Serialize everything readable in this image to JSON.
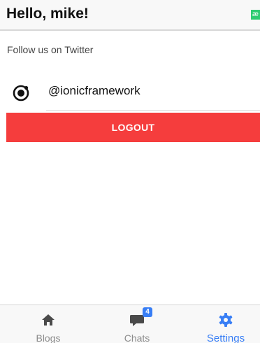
{
  "header": {
    "title": "Hello, mike!",
    "corner_badge": "æ"
  },
  "settings": {
    "section_label": "Follow us on Twitter",
    "twitter_handle": "@ionicframework",
    "twitter_icon": "ionic-logo-icon"
  },
  "logout_button": {
    "label": "LOGOUT",
    "color": "#f53d3d"
  },
  "tabs": [
    {
      "label": "Blogs",
      "icon": "home-icon",
      "selected": false
    },
    {
      "label": "Chats",
      "icon": "chat-icon",
      "badge": "4",
      "selected": false
    },
    {
      "label": "Settings",
      "icon": "gear-icon",
      "selected": true
    }
  ],
  "colors": {
    "active_tab": "#387ef5",
    "inactive_tab": "#8c8c8c",
    "corner_badge": "#2ecc71"
  }
}
